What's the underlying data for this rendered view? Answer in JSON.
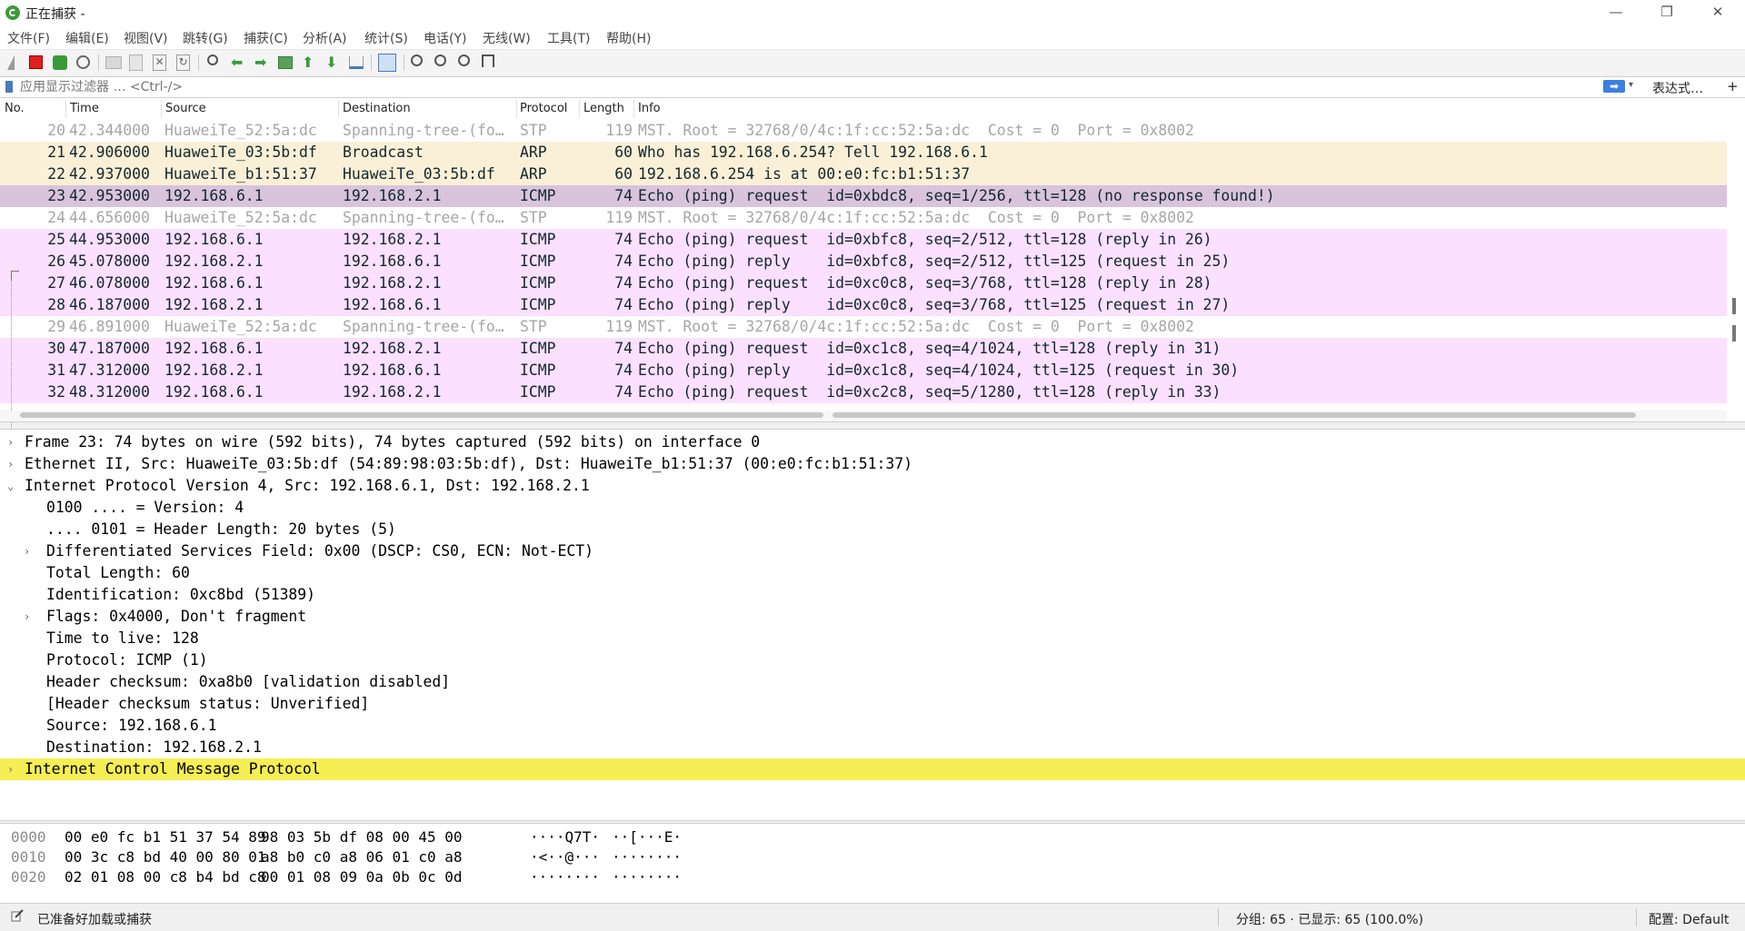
{
  "window": {
    "title": "正在捕获 -",
    "minimize": "—",
    "restore": "❐",
    "close": "✕"
  },
  "menu": [
    "文件(F)",
    "编辑(E)",
    "视图(V)",
    "跳转(G)",
    "捕获(C)",
    "分析(A)",
    "统计(S)",
    "电话(Y)",
    "无线(W)",
    "工具(T)",
    "帮助(H)"
  ],
  "filter": {
    "placeholder": "应用显示过滤器 … <Ctrl-/>",
    "apply_icon": "➡",
    "dropdown_icon": "▾",
    "expression_label": "表达式…",
    "add_label": "+"
  },
  "packet_list": {
    "columns": [
      "No.",
      "Time",
      "Source",
      "Destination",
      "Protocol",
      "Length",
      "Info"
    ],
    "rows": [
      {
        "no": "20",
        "time": "42.344000",
        "src": "HuaweiTe_52:5a:dc",
        "dst": "Spanning-tree-(fo…",
        "proto": "STP",
        "len": "119",
        "info": "MST. Root = 32768/0/4c:1f:cc:52:5a:dc  Cost = 0  Port = 0x8002",
        "type": "stp"
      },
      {
        "no": "21",
        "time": "42.906000",
        "src": "HuaweiTe_03:5b:df",
        "dst": "Broadcast",
        "proto": "ARP",
        "len": "60",
        "info": "Who has 192.168.6.254? Tell 192.168.6.1",
        "type": "arp"
      },
      {
        "no": "22",
        "time": "42.937000",
        "src": "HuaweiTe_b1:51:37",
        "dst": "HuaweiTe_03:5b:df",
        "proto": "ARP",
        "len": "60",
        "info": "192.168.6.254 is at 00:e0:fc:b1:51:37",
        "type": "arp"
      },
      {
        "no": "23",
        "time": "42.953000",
        "src": "192.168.6.1",
        "dst": "192.168.2.1",
        "proto": "ICMP",
        "len": "74",
        "info": "Echo (ping) request  id=0xbdc8, seq=1/256, ttl=128 (no response found!)",
        "type": "sel"
      },
      {
        "no": "24",
        "time": "44.656000",
        "src": "HuaweiTe_52:5a:dc",
        "dst": "Spanning-tree-(fo…",
        "proto": "STP",
        "len": "119",
        "info": "MST. Root = 32768/0/4c:1f:cc:52:5a:dc  Cost = 0  Port = 0x8002",
        "type": "stp"
      },
      {
        "no": "25",
        "time": "44.953000",
        "src": "192.168.6.1",
        "dst": "192.168.2.1",
        "proto": "ICMP",
        "len": "74",
        "info": "Echo (ping) request  id=0xbfc8, seq=2/512, ttl=128 (reply in 26)",
        "type": "icmp"
      },
      {
        "no": "26",
        "time": "45.078000",
        "src": "192.168.2.1",
        "dst": "192.168.6.1",
        "proto": "ICMP",
        "len": "74",
        "info": "Echo (ping) reply    id=0xbfc8, seq=2/512, ttl=125 (request in 25)",
        "type": "icmp"
      },
      {
        "no": "27",
        "time": "46.078000",
        "src": "192.168.6.1",
        "dst": "192.168.2.1",
        "proto": "ICMP",
        "len": "74",
        "info": "Echo (ping) request  id=0xc0c8, seq=3/768, ttl=128 (reply in 28)",
        "type": "icmp"
      },
      {
        "no": "28",
        "time": "46.187000",
        "src": "192.168.2.1",
        "dst": "192.168.6.1",
        "proto": "ICMP",
        "len": "74",
        "info": "Echo (ping) reply    id=0xc0c8, seq=3/768, ttl=125 (request in 27)",
        "type": "icmp"
      },
      {
        "no": "29",
        "time": "46.891000",
        "src": "HuaweiTe_52:5a:dc",
        "dst": "Spanning-tree-(fo…",
        "proto": "STP",
        "len": "119",
        "info": "MST. Root = 32768/0/4c:1f:cc:52:5a:dc  Cost = 0  Port = 0x8002",
        "type": "stp"
      },
      {
        "no": "30",
        "time": "47.187000",
        "src": "192.168.6.1",
        "dst": "192.168.2.1",
        "proto": "ICMP",
        "len": "74",
        "info": "Echo (ping) request  id=0xc1c8, seq=4/1024, ttl=128 (reply in 31)",
        "type": "icmp"
      },
      {
        "no": "31",
        "time": "47.312000",
        "src": "192.168.2.1",
        "dst": "192.168.6.1",
        "proto": "ICMP",
        "len": "74",
        "info": "Echo (ping) reply    id=0xc1c8, seq=4/1024, ttl=125 (request in 30)",
        "type": "icmp"
      },
      {
        "no": "32",
        "time": "48.312000",
        "src": "192.168.6.1",
        "dst": "192.168.2.1",
        "proto": "ICMP",
        "len": "74",
        "info": "Echo (ping) request  id=0xc2c8, seq=5/1280, ttl=128 (reply in 33)",
        "type": "icmp"
      }
    ]
  },
  "details": [
    {
      "arrow": "›",
      "indent": 0,
      "text": "Frame 23: 74 bytes on wire (592 bits), 74 bytes captured (592 bits) on interface 0"
    },
    {
      "arrow": "›",
      "indent": 0,
      "text": "Ethernet II, Src: HuaweiTe_03:5b:df (54:89:98:03:5b:df), Dst: HuaweiTe_b1:51:37 (00:e0:fc:b1:51:37)"
    },
    {
      "arrow": "⌄",
      "indent": 0,
      "text": "Internet Protocol Version 4, Src: 192.168.6.1, Dst: 192.168.2.1"
    },
    {
      "arrow": "",
      "indent": 1,
      "text": "0100 .... = Version: 4"
    },
    {
      "arrow": "",
      "indent": 1,
      "text": ".... 0101 = Header Length: 20 bytes (5)"
    },
    {
      "arrow": "›",
      "indent": 1,
      "text": "Differentiated Services Field: 0x00 (DSCP: CS0, ECN: Not-ECT)"
    },
    {
      "arrow": "",
      "indent": 1,
      "text": "Total Length: 60"
    },
    {
      "arrow": "",
      "indent": 1,
      "text": "Identification: 0xc8bd (51389)"
    },
    {
      "arrow": "›",
      "indent": 1,
      "text": "Flags: 0x4000, Don't fragment"
    },
    {
      "arrow": "",
      "indent": 1,
      "text": "Time to live: 128"
    },
    {
      "arrow": "",
      "indent": 1,
      "text": "Protocol: ICMP (1)"
    },
    {
      "arrow": "",
      "indent": 1,
      "text": "Header checksum: 0xa8b0 [validation disabled]"
    },
    {
      "arrow": "",
      "indent": 1,
      "text": "[Header checksum status: Unverified]"
    },
    {
      "arrow": "",
      "indent": 1,
      "text": "Source: 192.168.6.1"
    },
    {
      "arrow": "",
      "indent": 1,
      "text": "Destination: 192.168.2.1"
    },
    {
      "arrow": "›",
      "indent": 0,
      "text": "Internet Control Message Protocol",
      "highlight": true
    }
  ],
  "bytes": [
    {
      "offset": "0000",
      "hex1": "00 e0 fc b1 51 37 54 89",
      "hex2": "98 03 5b df 08 00 45 00",
      "ascii1": "····Q7T·",
      "ascii2": "··[···E·"
    },
    {
      "offset": "0010",
      "hex1": "00 3c c8 bd 40 00 80 01",
      "hex2": "a8 b0 c0 a8 06 01 c0 a8",
      "ascii1": "·<··@···",
      "ascii2": "········"
    },
    {
      "offset": "0020",
      "hex1": "02 01 08 00 c8 b4 bd c8",
      "hex2": "00 01 08 09 0a 0b 0c 0d",
      "ascii1": "········",
      "ascii2": "········"
    }
  ],
  "status": {
    "text": "已准备好加载或捕获",
    "packets": "分组: 65 · 已显示: 65 (100.0%)",
    "profile": "配置: Default"
  },
  "colors": {
    "stp_text": "#a6a6a6",
    "arp_bg": "#faf0d7",
    "icmp_bg": "#fce0ff",
    "selected_bg": "#d9c3dd",
    "highlight_bg": "#f5ef55"
  }
}
